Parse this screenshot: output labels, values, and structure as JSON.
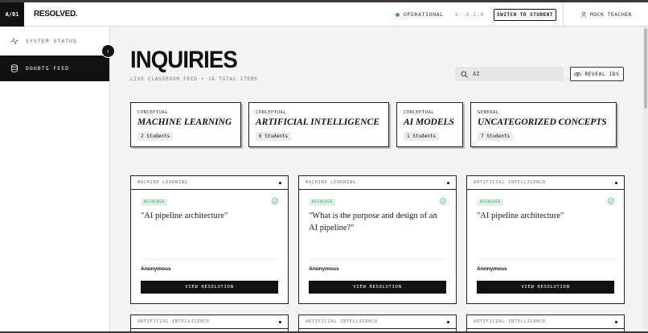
{
  "header": {
    "brand_code": "A/01",
    "brand_name": "RESOLVED.",
    "status": "OPERATIONAL",
    "version": "V. 5.1.0",
    "switch_label": "SWITCH TO STUDENT",
    "user_label": "MOCK TEACHER",
    "status_color": "#2bb36b"
  },
  "sidebar": {
    "items": [
      {
        "label": "SYSTEM STATUS",
        "icon": "activity-icon"
      },
      {
        "label": "DOUBTS FEED",
        "icon": "database-icon"
      }
    ]
  },
  "main": {
    "title": "INQUIRIES",
    "subtitle": "LIVE CLASSROOM FEED • 16 TOTAL ITEMS",
    "search": {
      "value": "AI",
      "placeholder": "Search..."
    },
    "reveal_label": "REVEAL IDS"
  },
  "topics": [
    {
      "category": "CONCEPTUAL",
      "name": "MACHINE LEARNING",
      "count": "2 Students"
    },
    {
      "category": "CONCEPTUAL",
      "name": "ARTIFICIAL INTELLIGENCE",
      "count": "6 Students"
    },
    {
      "category": "CONCEPTUAL",
      "name": "AI MODELS",
      "count": "1 Students"
    },
    {
      "category": "GENERAL",
      "name": "UNCATEGORIZED CONCEPTS",
      "count": "7 Students"
    }
  ],
  "cards": [
    {
      "topic": "MACHINE LEARNING",
      "badge": "RESOLVED",
      "question": "\"AI pipeline architecture\"",
      "author": "Anonymous",
      "action": "VIEW RESOLUTION"
    },
    {
      "topic": "MACHINE LEARNING",
      "badge": "RESOLVED",
      "question": "\"What is the purpose and design of an AI pipeline?\"",
      "author": "Anonymous",
      "action": "VIEW RESOLUTION"
    },
    {
      "topic": "ARTIFICIAL INTELLIGENCE",
      "badge": "RESOLVED",
      "question": "\"AI pipeline architecture\"",
      "author": "Anonymous",
      "action": "VIEW RESOLUTION"
    }
  ],
  "cards_row2": [
    {
      "topic": "ARTIFICIAL INTELLIGENCE"
    },
    {
      "topic": "ARTIFICIAL INTELLIGENCE"
    },
    {
      "topic": "ARTIFICIAL INTELLIGENCE"
    }
  ]
}
